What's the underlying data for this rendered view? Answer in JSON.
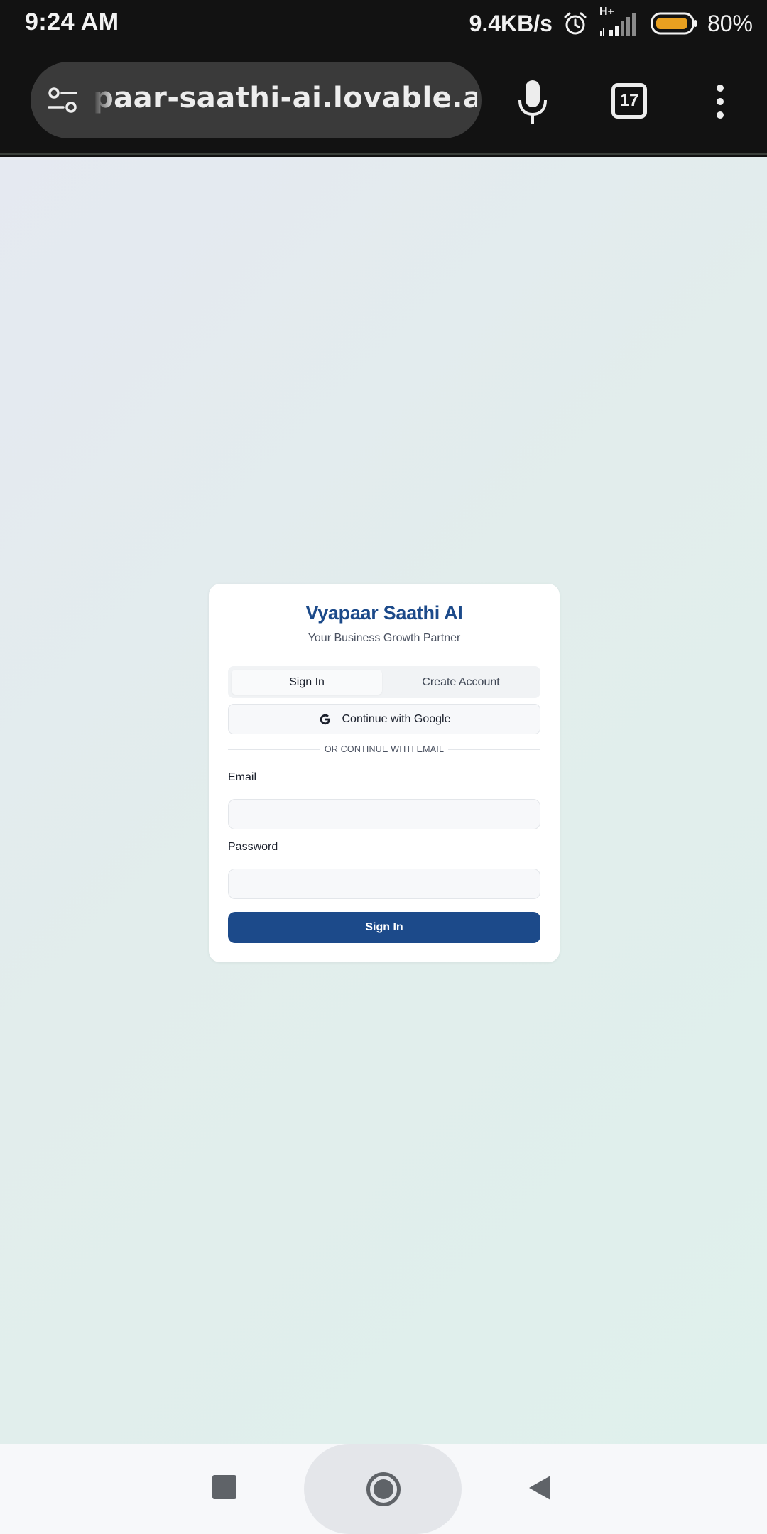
{
  "status_bar": {
    "time": "9:24 AM",
    "net_speed": "9.4KB/s",
    "network_type": "H+",
    "battery": "80%",
    "icons": [
      "alarm-icon",
      "signal-icon",
      "battery-icon"
    ]
  },
  "browser": {
    "url": "paar-saathi-ai.lovable.app",
    "tab_count": "17",
    "icons": [
      "tune-icon",
      "mic-icon",
      "tabs-icon",
      "more-vert-icon"
    ]
  },
  "auth_card": {
    "title": "Vyapaar Saathi AI",
    "subtitle": "Your Business Growth Partner",
    "tabs": [
      {
        "label": "Sign In",
        "active": true
      },
      {
        "label": "Create Account",
        "active": false
      }
    ],
    "google_button": "Continue with Google",
    "divider_text": "OR CONTINUE WITH EMAIL",
    "email_label": "Email",
    "email_value": "",
    "password_label": "Password",
    "password_value": "",
    "submit_label": "Sign In"
  },
  "colors": {
    "brand": "#1c4a8a",
    "battery": "#e8a020"
  },
  "nav_bar": {
    "icons": [
      "recents-icon",
      "home-icon",
      "back-icon"
    ]
  }
}
